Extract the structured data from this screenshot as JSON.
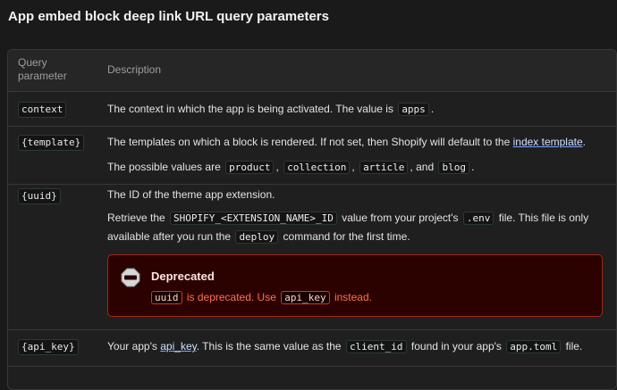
{
  "heading": "App embed block deep link URL query parameters",
  "table": {
    "headers": {
      "param": "Query parameter",
      "desc": "Description"
    },
    "rows": [
      {
        "param": "context",
        "line1": {
          "t1": "The context in which the app is being activated. The value is",
          "c1": "apps",
          "t2": "."
        }
      },
      {
        "param": "{template}",
        "line1": {
          "t1": "The templates on which a block is rendered. If not set, then Shopify will default to the",
          "link": "index template",
          "t2": "."
        },
        "line2": {
          "t1": "The possible values are",
          "c1": "product",
          "s1": ",",
          "c2": "collection",
          "s2": ",",
          "c3": "article",
          "s3": ", and",
          "c4": "blog",
          "t2": "."
        }
      },
      {
        "param": "{uuid}",
        "line1": {
          "t1": "The ID of the theme app extension."
        },
        "line2": {
          "t1": "Retrieve the",
          "c1": "SHOPIFY_<EXTENSION_NAME>_ID",
          "t2": "value from your project's",
          "c2": ".env",
          "t3": "file. This file is only available after you run the",
          "c3": "deploy",
          "t4": "command for the first time."
        },
        "callout": {
          "title": "Deprecated",
          "c1": "uuid",
          "t1": "is deprecated. Use",
          "c2": "api_key",
          "t2": "instead.",
          "color": "#ff6e55",
          "icon": "deprecated-icon"
        }
      },
      {
        "param": "{api_key}",
        "line1": {
          "t1": "Your app's",
          "link": "api_key",
          "t2": ". This is the same value as the",
          "c1": "client_id",
          "t3": "found in your app's",
          "c2": "app.toml",
          "t4": "file."
        }
      }
    ]
  }
}
